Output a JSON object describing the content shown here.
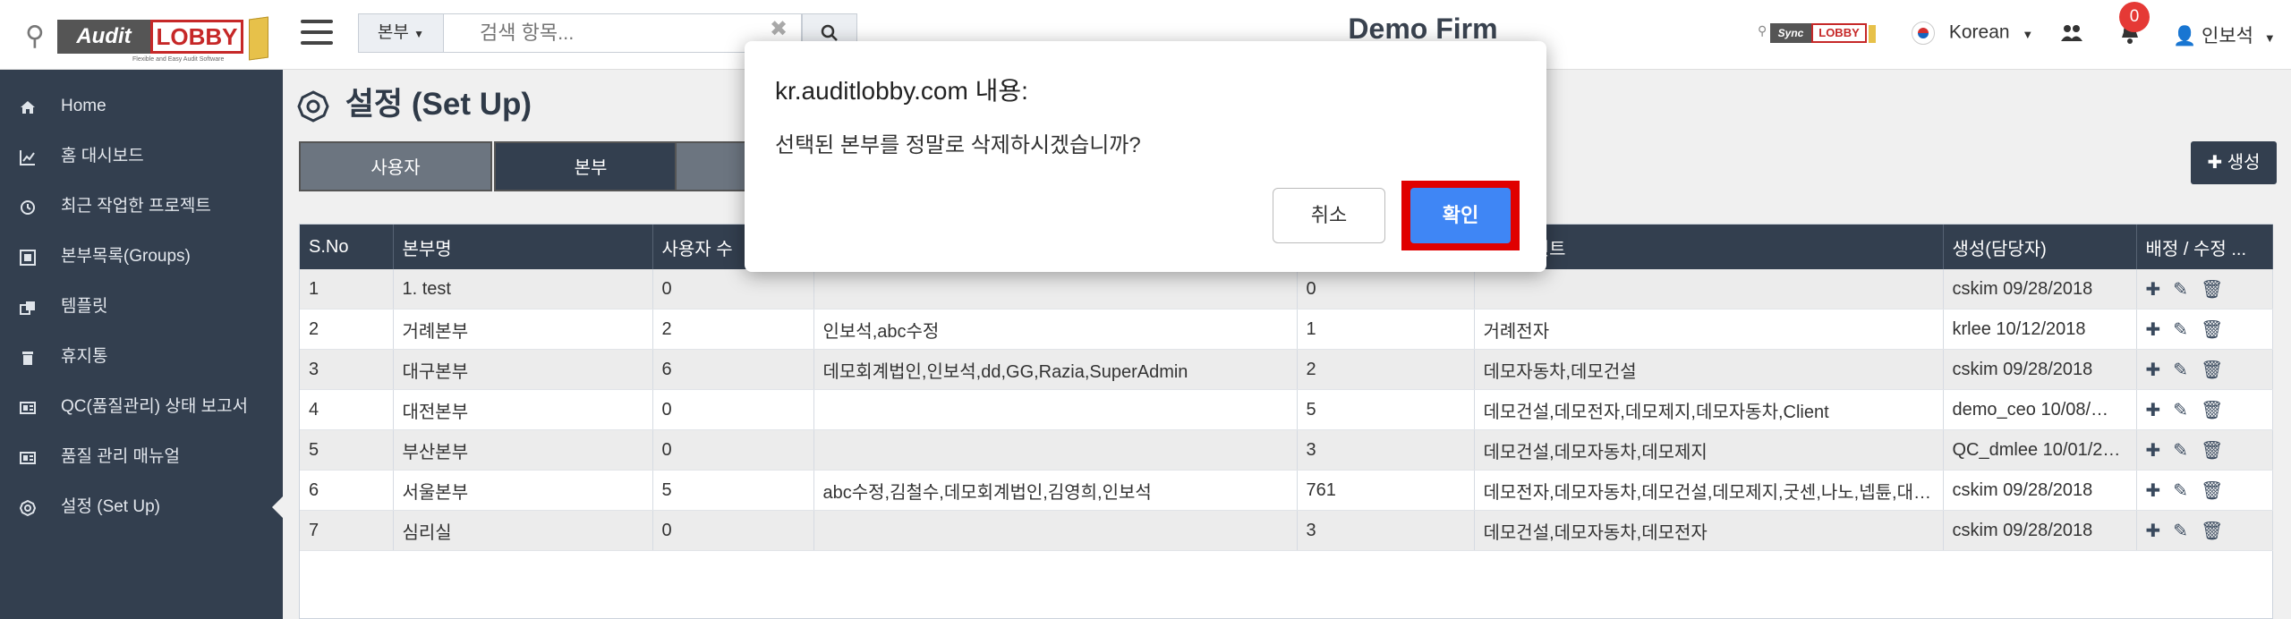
{
  "header": {
    "scope_label": "본부",
    "search_placeholder": "검색 항목...",
    "firm_title": "Demo Firm",
    "language": "Korean",
    "notification_count": "0",
    "user_name": "인보석",
    "logo_text_1": "Audit",
    "logo_text_2": "LOBBY",
    "logo_tagline": "Flexible and Easy Audit Software",
    "sync_logo_1": "Sync",
    "sync_logo_2": "LOBBY"
  },
  "sidebar": {
    "items": [
      {
        "label": "Home",
        "icon": "home-icon"
      },
      {
        "label": "홈 대시보드",
        "icon": "chart-line-icon"
      },
      {
        "label": "최근 작업한 프로젝트",
        "icon": "clock-icon"
      },
      {
        "label": "본부목록(Groups)",
        "icon": "groups-icon"
      },
      {
        "label": "템플릿",
        "icon": "template-icon"
      },
      {
        "label": "휴지통",
        "icon": "trash-icon"
      },
      {
        "label": "QC(품질관리) 상태 보고서",
        "icon": "report-icon"
      },
      {
        "label": "품질 관리 매뉴얼",
        "icon": "manual-icon"
      },
      {
        "label": "설정 (Set Up)",
        "icon": "gear-icon",
        "active": true
      }
    ]
  },
  "page": {
    "title": "설정 (Set Up)",
    "tabs": [
      "사용자",
      "본부",
      ""
    ],
    "create_label": "✚ 생성"
  },
  "table": {
    "headers": [
      "S.No",
      "본부명",
      "사용자 수",
      "",
      "",
      "클라이언트",
      "생성(담당자)",
      "배정 / 수정 ..."
    ],
    "rows": [
      [
        "1",
        "1. test",
        "0",
        "",
        "0",
        "",
        "cskim 09/28/2018"
      ],
      [
        "2",
        "거례본부",
        "2",
        "인보석,abc수정",
        "1",
        "거례전자",
        "krlee 10/12/2018"
      ],
      [
        "3",
        "대구본부",
        "6",
        "데모회계법인,인보석,dd,GG,Razia,SuperAdmin",
        "2",
        "데모자동차,데모건설",
        "cskim 09/28/2018"
      ],
      [
        "4",
        "대전본부",
        "0",
        "",
        "5",
        "데모건설,데모전자,데모제지,데모자동차,Client",
        "demo_ceo 10/08/…"
      ],
      [
        "5",
        "부산본부",
        "0",
        "",
        "3",
        "데모건설,데모자동차,데모제지",
        "QC_dmlee 10/01/2…"
      ],
      [
        "6",
        "서울본부",
        "5",
        "abc수정,김철수,데모회계법인,김영희,인보석",
        "761",
        "데모전자,데모자동차,데모건설,데모제지,굿센,나노,넵튠,대…",
        "cskim 09/28/2018"
      ],
      [
        "7",
        "심리실",
        "0",
        "",
        "3",
        "데모건설,데모자동차,데모전자",
        "cskim 09/28/2018"
      ]
    ]
  },
  "dialog": {
    "title": "kr.auditlobby.com 내용:",
    "message": "선택된 본부를 정말로 삭제하시겠습니까?",
    "cancel_label": "취소",
    "ok_label": "확인"
  },
  "colors": {
    "sidebar_bg": "#333f4f",
    "ok_button": "#3f86f5",
    "highlight_frame": "#e00000"
  }
}
